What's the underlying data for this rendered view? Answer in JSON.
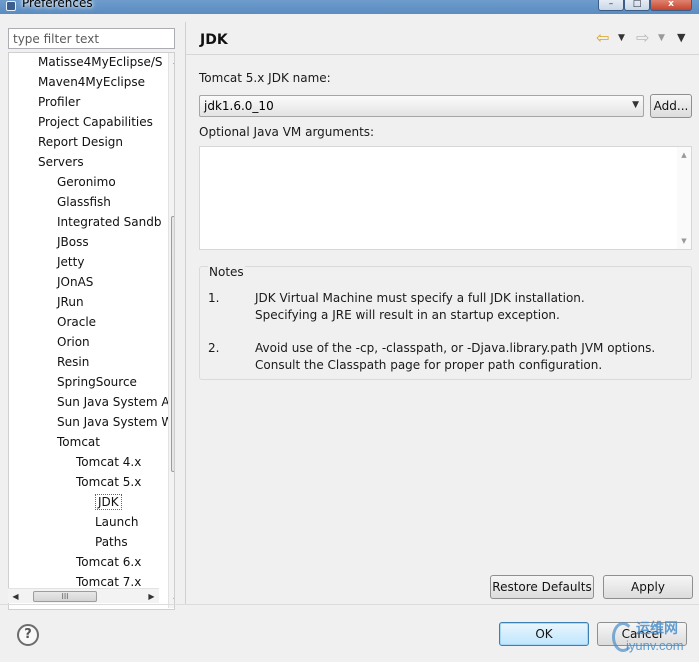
{
  "window": {
    "title": "Preferences"
  },
  "filter": {
    "placeholder": "type filter text"
  },
  "tree": {
    "items": [
      {
        "label": "Matisse4MyEclipse/S"
      },
      {
        "label": "Maven4MyEclipse"
      },
      {
        "label": "Profiler"
      },
      {
        "label": "Project Capabilities"
      },
      {
        "label": "Report Design"
      },
      {
        "label": "Servers"
      },
      {
        "label": "Geronimo"
      },
      {
        "label": "Glassfish"
      },
      {
        "label": "Integrated Sandb"
      },
      {
        "label": "JBoss"
      },
      {
        "label": "Jetty"
      },
      {
        "label": "JOnAS"
      },
      {
        "label": "JRun"
      },
      {
        "label": "Oracle"
      },
      {
        "label": "Orion"
      },
      {
        "label": "Resin"
      },
      {
        "label": "SpringSource"
      },
      {
        "label": "Sun Java System A"
      },
      {
        "label": "Sun Java System W"
      },
      {
        "label": "Tomcat"
      },
      {
        "label": "Tomcat  4.x"
      },
      {
        "label": "Tomcat  5.x"
      },
      {
        "label": "JDK"
      },
      {
        "label": "Launch"
      },
      {
        "label": "Paths"
      },
      {
        "label": "Tomcat  6.x"
      },
      {
        "label": "Tomcat  7.x"
      }
    ],
    "selected": "JDK",
    "scroll_grip": "≡",
    "hscroll_grip": "III"
  },
  "page": {
    "title": "JDK",
    "jdk_name_label": "Tomcat  5.x JDK name:",
    "jdk_selected": "jdk1.6.0_10",
    "add_label": "Add...",
    "vm_args_label": "Optional Java VM arguments:",
    "vm_args_value": "",
    "notes_title": "Notes",
    "notes": [
      {
        "num": "1.",
        "lines": [
          "JDK Virtual Machine must specify a full JDK installation.",
          "Specifying a JRE will result in an startup exception."
        ]
      },
      {
        "num": "2.",
        "lines": [
          "Avoid use of the -cp, -classpath, or -Djava.library.path JVM options.",
          "Consult the Classpath page for proper path configuration."
        ]
      }
    ],
    "restore_defaults_label": "Restore Defaults",
    "apply_label": "Apply"
  },
  "footer": {
    "help_symbol": "?",
    "ok_label": "OK",
    "cancel_label": "Cancel"
  },
  "watermark": {
    "line1": "运维网",
    "line2": "iyunv.com"
  },
  "colors": {
    "ok_border": "#3c7fb1",
    "back_arrow": "#d9a421"
  }
}
